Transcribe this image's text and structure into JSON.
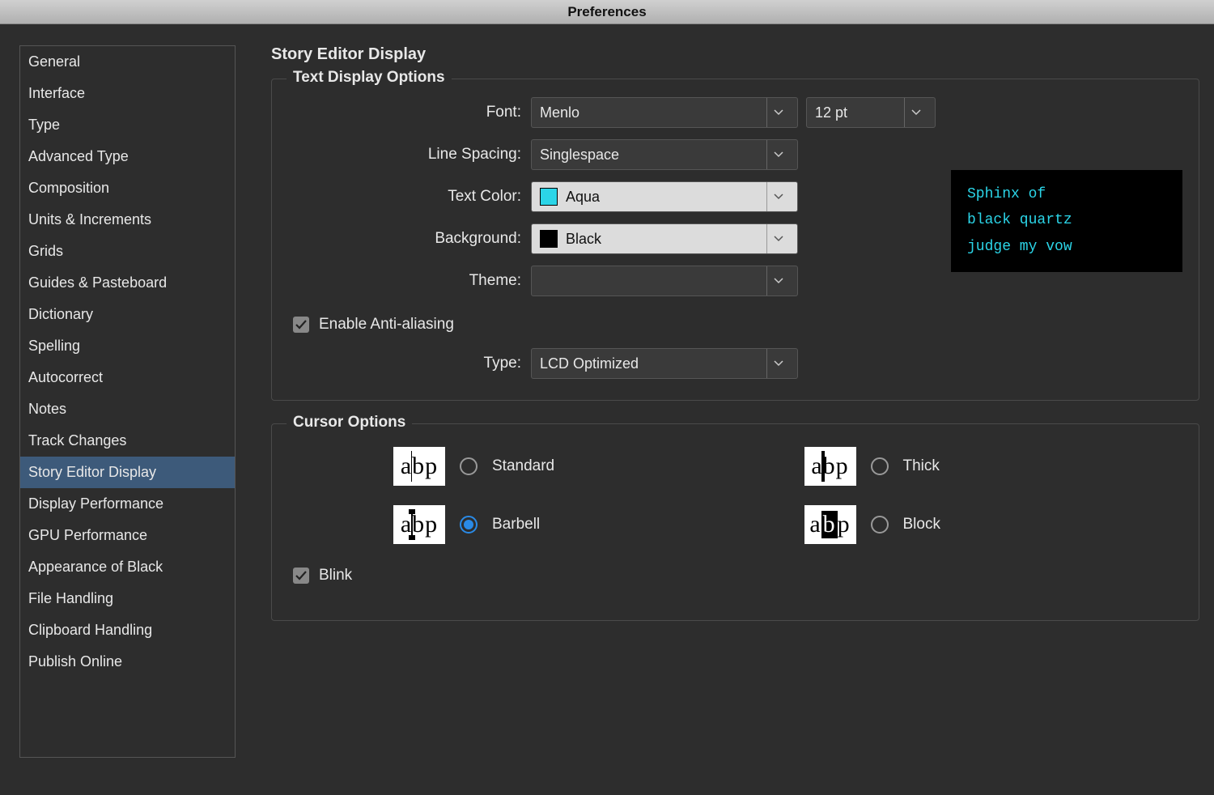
{
  "window": {
    "title": "Preferences"
  },
  "sidebar": {
    "items": [
      {
        "label": "General"
      },
      {
        "label": "Interface"
      },
      {
        "label": "Type"
      },
      {
        "label": "Advanced Type"
      },
      {
        "label": "Composition"
      },
      {
        "label": "Units & Increments"
      },
      {
        "label": "Grids"
      },
      {
        "label": "Guides & Pasteboard"
      },
      {
        "label": "Dictionary"
      },
      {
        "label": "Spelling"
      },
      {
        "label": "Autocorrect"
      },
      {
        "label": "Notes"
      },
      {
        "label": "Track Changes"
      },
      {
        "label": "Story Editor Display",
        "selected": true
      },
      {
        "label": "Display Performance"
      },
      {
        "label": "GPU Performance"
      },
      {
        "label": "Appearance of Black"
      },
      {
        "label": "File Handling"
      },
      {
        "label": "Clipboard Handling"
      },
      {
        "label": "Publish Online"
      }
    ]
  },
  "main": {
    "title": "Story Editor Display",
    "text_display": {
      "legend": "Text Display Options",
      "font_label": "Font:",
      "font_value": "Menlo",
      "font_size": "12 pt",
      "line_spacing_label": "Line Spacing:",
      "line_spacing_value": "Singlespace",
      "text_color_label": "Text Color:",
      "text_color_value": "Aqua",
      "text_color_swatch": "#2bd5e8",
      "background_label": "Background:",
      "background_value": "Black",
      "background_swatch": "#000000",
      "theme_label": "Theme:",
      "theme_value": "",
      "enable_aa_label": "Enable Anti-aliasing",
      "enable_aa_checked": true,
      "type_label": "Type:",
      "type_value": "LCD Optimized",
      "preview_line1": "Sphinx of",
      "preview_line2": "black quartz",
      "preview_line3": "judge my vow"
    },
    "cursor": {
      "legend": "Cursor Options",
      "options": [
        {
          "label": "Standard",
          "style": "thin"
        },
        {
          "label": "Thick",
          "style": "thick"
        },
        {
          "label": "Barbell",
          "style": "barbell",
          "checked": true
        },
        {
          "label": "Block",
          "style": "block"
        }
      ],
      "blink_label": "Blink",
      "blink_checked": true
    }
  }
}
